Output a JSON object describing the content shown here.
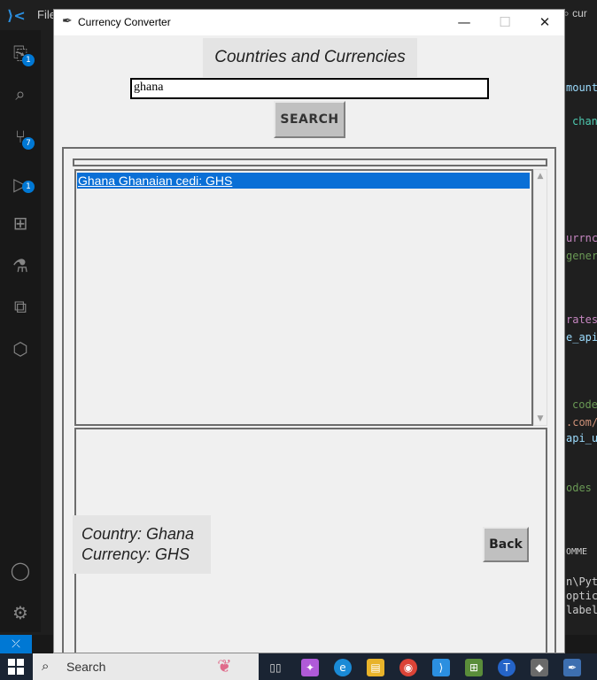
{
  "vscode": {
    "menu_file": "File",
    "search_partial": "cur",
    "badges": [
      "1",
      "7",
      "1"
    ],
    "code_snippets": [
      {
        "text": "mount",
        "color": "#9cdcfe"
      },
      {
        "text": "chan",
        "color": "#4ec9b0"
      },
      {
        "text": "urrnc",
        "color": "#c586c0"
      },
      {
        "text": "gener",
        "color": "#6a9955"
      },
      {
        "text": "rates",
        "color": "#c586c0"
      },
      {
        "text": "e_api",
        "color": "#9cdcfe"
      },
      {
        "text": "code",
        "color": "#6a9955"
      },
      {
        "text": ".com/",
        "color": "#ce9178"
      },
      {
        "text": "api_u",
        "color": "#9cdcfe"
      },
      {
        "text": "odes",
        "color": "#6a9955"
      },
      {
        "text": "OMME",
        "color": "#cccccc"
      },
      {
        "text": "n\\Pyt",
        "color": "#cccccc"
      },
      {
        "text": "optic",
        "color": "#cccccc"
      },
      {
        "text": "label",
        "color": "#cccccc"
      }
    ]
  },
  "window": {
    "title": "Currency Converter",
    "minimize": "—",
    "maximize": "☐",
    "close": "✕"
  },
  "app": {
    "heading": "Countries and Currencies",
    "search_value": "ghana",
    "search_button": "SEARCH",
    "results": [
      "Ghana Ghanaian cedi: GHS"
    ],
    "selected_index": 0,
    "country_line": "Country: Ghana",
    "currency_line": "Currency: GHS",
    "back_button": "Back"
  },
  "taskbar": {
    "search_label": "Search"
  },
  "colors": {
    "selection": "#0a6fd6",
    "vscode_accent": "#0078d4",
    "taskbar_bg": "#1a2433"
  }
}
